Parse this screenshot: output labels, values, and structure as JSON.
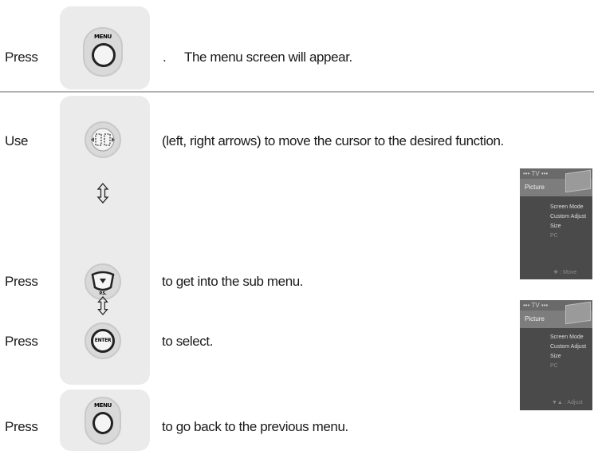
{
  "rows": {
    "row1": {
      "press_label": "Press",
      "dot": ".",
      "text": "The menu screen will appear.",
      "button_label": "MENU"
    },
    "row2": {
      "use_label": "Use",
      "text": "(left, right arrows) to move the cursor to the desired function."
    },
    "row3": {
      "press_label": "Press",
      "text": "to get into the sub menu.",
      "button_label": "P.S."
    },
    "row4": {
      "press_label": "Press",
      "text": "to select.",
      "button_label": "ENTER"
    },
    "row5": {
      "press_label": "Press",
      "text": "to go back to the previous menu.",
      "button_label": "MENU"
    }
  },
  "screen1": {
    "tv_label": "••• TV •••",
    "category": "Picture",
    "items": [
      "Screen Mode",
      "Custom Adjust",
      "Size",
      "PC"
    ],
    "footer": "❖ : Move"
  },
  "screen2": {
    "tv_label": "••• TV •••",
    "category": "Picture",
    "items": [
      "Screen Mode",
      "Custom Adjust",
      "Size",
      "PC"
    ],
    "footer": "▼▲ : Adjust"
  }
}
